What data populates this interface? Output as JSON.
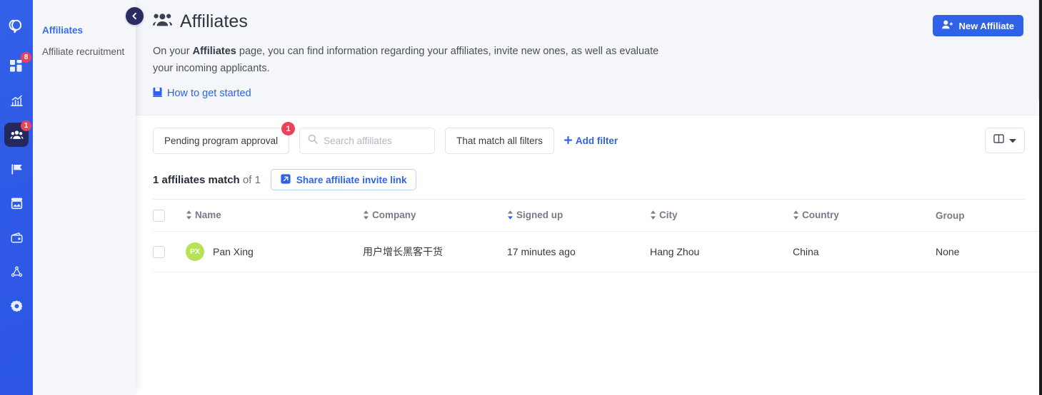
{
  "colors": {
    "rail_blue": "#2f5ae6",
    "accent": "#2f62e8",
    "badge_red": "#ec4159",
    "active_nav": "#23295c",
    "avatar_green": "#b6e356"
  },
  "rail": {
    "logo_name": "app-logo",
    "items": [
      {
        "name": "dashboard-icon",
        "badge": "8",
        "active": false
      },
      {
        "name": "analytics-icon",
        "badge": "",
        "active": false
      },
      {
        "name": "affiliates-icon",
        "badge": "1",
        "active": true
      },
      {
        "name": "campaigns-flag-icon",
        "badge": "",
        "active": false
      },
      {
        "name": "media-icon",
        "badge": "",
        "active": false
      },
      {
        "name": "payouts-wallet-icon",
        "badge": "",
        "active": false
      },
      {
        "name": "network-icon",
        "badge": "",
        "active": false
      },
      {
        "name": "settings-gear-icon",
        "badge": "",
        "active": false
      }
    ]
  },
  "subnav": {
    "items": [
      {
        "label": "Affiliates",
        "active": true
      },
      {
        "label": "Affiliate recruitment",
        "active": false
      }
    ],
    "collapse_label": "‹"
  },
  "header": {
    "title": "Affiliates",
    "title_icon": "users-group-icon",
    "desc_part1": "On your ",
    "desc_bold": "Affiliates",
    "desc_part2": " page, you can find information regarding your affiliates, invite new ones, as well as evaluate your incoming applicants.",
    "howto_label": "How to get started",
    "howto_icon": "book-icon",
    "new_button_label": "New Affiliate",
    "new_button_icon": "user-plus-icon"
  },
  "toolbar": {
    "filter_pill_label": "Pending program approval",
    "filter_pill_badge": "1",
    "search_placeholder": "Search affiliates",
    "search_value": "",
    "search_icon": "search-icon",
    "match_label": "That match all filters",
    "add_filter_label": "Add filter",
    "add_filter_icon": "plus-icon",
    "columns_icon": "columns-icon",
    "columns_caret_icon": "chevron-down-icon"
  },
  "results": {
    "count_bold": "1 affiliates match",
    "count_rest": " of 1",
    "share_label": "Share affiliate invite link",
    "share_icon": "external-link-icon"
  },
  "table": {
    "columns": [
      {
        "key": "name",
        "label": "Name",
        "sortable": true,
        "sorted": "none"
      },
      {
        "key": "company",
        "label": "Company",
        "sortable": true,
        "sorted": "none"
      },
      {
        "key": "signed",
        "label": "Signed up",
        "sortable": true,
        "sorted": "desc"
      },
      {
        "key": "city",
        "label": "City",
        "sortable": true,
        "sorted": "none"
      },
      {
        "key": "country",
        "label": "Country",
        "sortable": true,
        "sorted": "none"
      },
      {
        "key": "group",
        "label": "Group",
        "sortable": false,
        "sorted": "none"
      }
    ],
    "rows": [
      {
        "selected": false,
        "avatar_initials": "PX",
        "name": "Pan Xing",
        "company": "用户增长黑客干货",
        "signed": "17 minutes ago",
        "city": "Hang Zhou",
        "country": "China",
        "group": "None"
      }
    ]
  }
}
